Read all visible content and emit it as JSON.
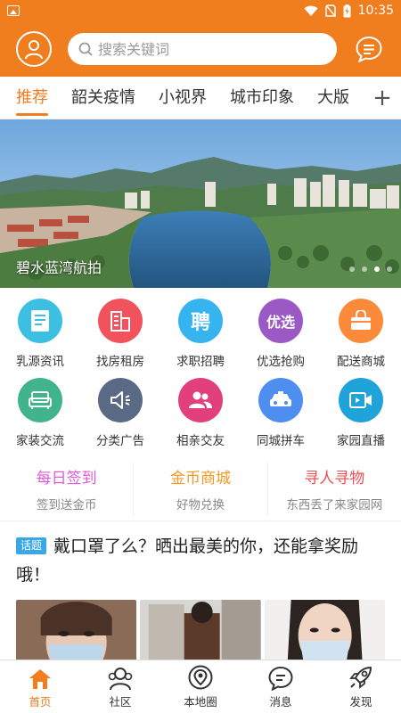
{
  "status": {
    "time": "10:35"
  },
  "header": {
    "search_placeholder": "搜索关键词"
  },
  "tabs": [
    {
      "label": "推荐",
      "active": true
    },
    {
      "label": "韶关疫情"
    },
    {
      "label": "小视界"
    },
    {
      "label": "城市印象"
    },
    {
      "label": "大版"
    }
  ],
  "banner": {
    "caption": "碧水蓝湾航拍",
    "slide_count": 4,
    "active_slide": 3
  },
  "grid": [
    {
      "label": "乳源资讯",
      "icon": "newspaper-icon",
      "color": "#3cbfe0"
    },
    {
      "label": "找房租房",
      "icon": "building-icon",
      "color": "#f2525c"
    },
    {
      "label": "求职招聘",
      "icon": "recruit-icon",
      "color": "#36b4ef",
      "glyph": "聘"
    },
    {
      "label": "优选抢购",
      "icon": "flash-sale-icon",
      "color": "#9b59c6",
      "glyph": "优选"
    },
    {
      "label": "配送商城",
      "icon": "shopping-bag-icon",
      "color": "#fb8a3a"
    },
    {
      "label": "家装交流",
      "icon": "sofa-icon",
      "color": "#41b48e"
    },
    {
      "label": "分类广告",
      "icon": "megaphone-icon",
      "color": "#5b6a84"
    },
    {
      "label": "相亲交友",
      "icon": "people-icon",
      "color": "#e2407d"
    },
    {
      "label": "同城拼车",
      "icon": "taxi-icon",
      "color": "#4e8ef0"
    },
    {
      "label": "家园直播",
      "icon": "video-icon",
      "color": "#1fa3d9"
    }
  ],
  "promos": [
    {
      "title": "每日签到",
      "subtitle": "签到送金币",
      "color": "#e15ad8"
    },
    {
      "title": "金币商城",
      "subtitle": "好物兑换",
      "color": "#f29a22"
    },
    {
      "title": "寻人寻物",
      "subtitle": "东西丢了来家园网",
      "color": "#ef4e55"
    }
  ],
  "topic": {
    "badge": "话题",
    "title": "戴口罩了么？晒出最美的你，还能拿奖励哦！"
  },
  "bottomnav": [
    {
      "label": "首页",
      "icon": "home-icon",
      "active": true
    },
    {
      "label": "社区",
      "icon": "community-icon"
    },
    {
      "label": "本地圈",
      "icon": "local-circle-icon"
    },
    {
      "label": "消息",
      "icon": "message-icon"
    },
    {
      "label": "发现",
      "icon": "rocket-icon"
    }
  ],
  "colors": {
    "brand": "#f07d1e"
  }
}
